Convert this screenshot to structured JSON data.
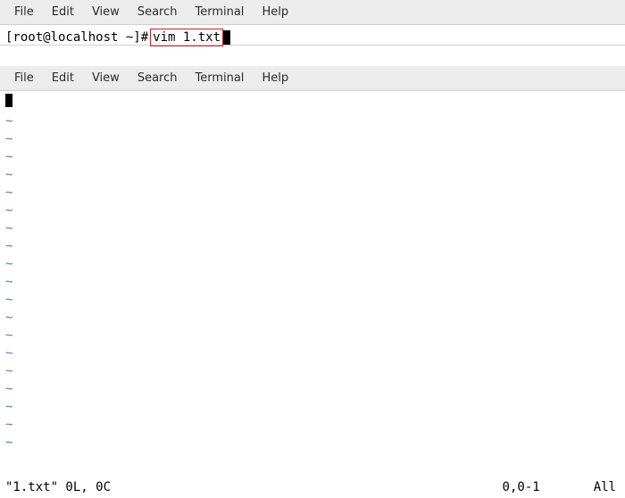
{
  "menu": {
    "file": "File",
    "edit": "Edit",
    "view": "View",
    "search": "Search",
    "terminal": "Terminal",
    "help": "Help"
  },
  "prompt": {
    "text": "[root@localhost ~]#",
    "command": "vim 1.txt"
  },
  "vim": {
    "tilde": "~",
    "status_left": "\"1.txt\" 0L, 0C",
    "status_pos": "0,0-1",
    "status_all": "All"
  }
}
